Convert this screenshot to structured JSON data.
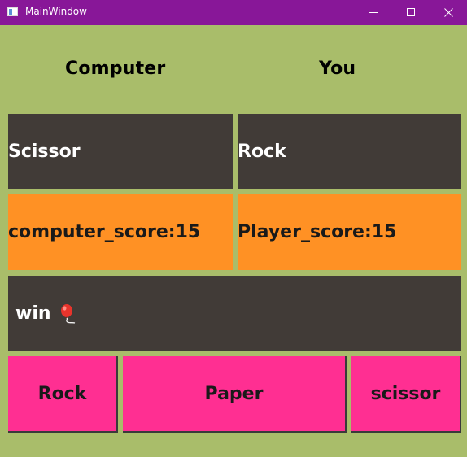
{
  "window": {
    "title": "MainWindow",
    "minimize_icon": "minimize-icon",
    "maximize_icon": "maximize-icon",
    "close_icon": "close-icon"
  },
  "labels": {
    "computer": "Computer",
    "you": "You"
  },
  "choices": {
    "computer": "Scissor",
    "player": "Rock"
  },
  "scores": {
    "computer": "computer_score:15",
    "player": "Player_score:15"
  },
  "result": {
    "text": "win",
    "icon": "balloon-icon"
  },
  "buttons": {
    "rock": "Rock",
    "paper": "Paper",
    "scissor": "scissor"
  },
  "colors": {
    "titlebar": "#881798",
    "background": "#a9bd6a",
    "dark_panel": "#413b37",
    "score_panel": "#ff9124",
    "button": "#ff2f92"
  }
}
